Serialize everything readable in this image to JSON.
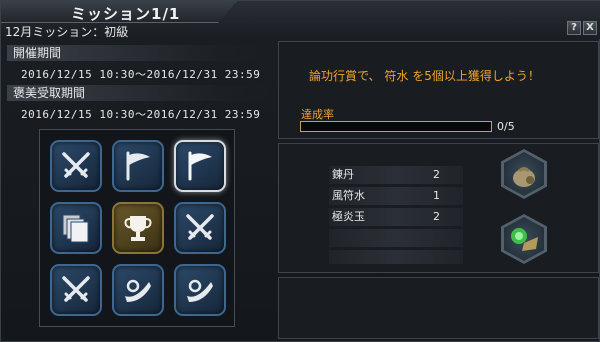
{
  "window": {
    "title": "ミッション1/1",
    "subtitle": "12月ミッション：初級",
    "help_label": "?",
    "close_label": "X"
  },
  "period": {
    "label": "開催期間",
    "range": "2016/12/15 10:30～2016/12/31 23:59"
  },
  "reward_period": {
    "label": "褒美受取期間",
    "range": "2016/12/15 10:30～2016/12/31 23:59"
  },
  "mission_grid": {
    "tiles": [
      {
        "icon": "crossed-swords-icon",
        "state": "normal"
      },
      {
        "icon": "flag-icon",
        "state": "normal"
      },
      {
        "icon": "flag-icon",
        "state": "selected"
      },
      {
        "icon": "cards-icon",
        "state": "normal"
      },
      {
        "icon": "trophy-icon",
        "state": "gold"
      },
      {
        "icon": "crossed-swords-icon",
        "state": "normal"
      },
      {
        "icon": "crossed-swords-icon",
        "state": "normal"
      },
      {
        "icon": "horn-icon",
        "state": "normal"
      },
      {
        "icon": "horn-icon",
        "state": "normal"
      }
    ]
  },
  "objective": {
    "prefix": "論功行賞で、",
    "item": "符水",
    "middle": "を",
    "count": "5",
    "suffix": "個以上獲得しよう！"
  },
  "achievement": {
    "label": "達成率",
    "current": 0,
    "target": 5,
    "text": "0/5"
  },
  "rewards": {
    "items": [
      {
        "name": "錬丹",
        "qty": "2"
      },
      {
        "name": "風符水",
        "qty": "1"
      },
      {
        "name": "極炎玉",
        "qty": "2"
      }
    ],
    "icons": [
      "pouch-icon",
      "jade-item-icon"
    ]
  },
  "colors": {
    "accent": "#f0a42a",
    "progress_border": "#c2a25a",
    "tile_blue": "#3d6690",
    "tile_gold": "#8a7436"
  }
}
